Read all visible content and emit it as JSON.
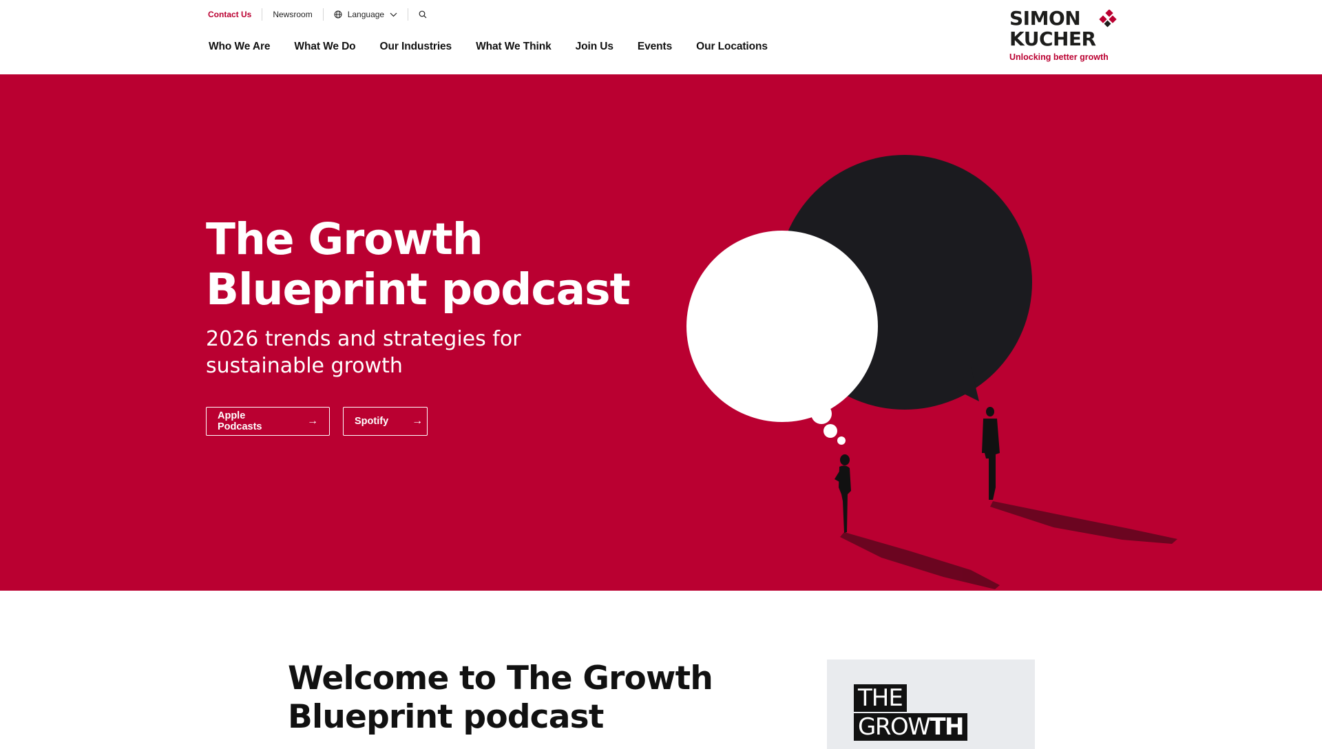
{
  "utility_nav": {
    "contact": "Contact Us",
    "newsroom": "Newsroom",
    "language": "Language",
    "search_icon": "search-icon"
  },
  "main_nav": [
    {
      "label": "Who We Are"
    },
    {
      "label": "What We Do"
    },
    {
      "label": "Our Industries"
    },
    {
      "label": "What We Think"
    },
    {
      "label": "Join Us"
    },
    {
      "label": "Events"
    },
    {
      "label": "Our Locations"
    }
  ],
  "logo": {
    "line1": "SIMON",
    "line2": "KUCHER",
    "tagline": "Unlocking better growth"
  },
  "hero": {
    "title": "The Growth Blueprint podcast",
    "subtitle": "2026 trends and strategies for sustainable growth",
    "buttons": [
      {
        "label": "Apple Podcasts",
        "icon": "arrow-right-icon"
      },
      {
        "label": "Spotify",
        "icon": "arrow-right-icon"
      }
    ]
  },
  "welcome": {
    "heading": "Welcome to The Growth Blueprint podcast"
  },
  "cover": {
    "word1": "THE",
    "word2_light": "GROW",
    "word2_bold": "TH"
  },
  "colors": {
    "brand_red": "#ba0031",
    "dark": "#1b1b1f",
    "white": "#ffffff"
  }
}
